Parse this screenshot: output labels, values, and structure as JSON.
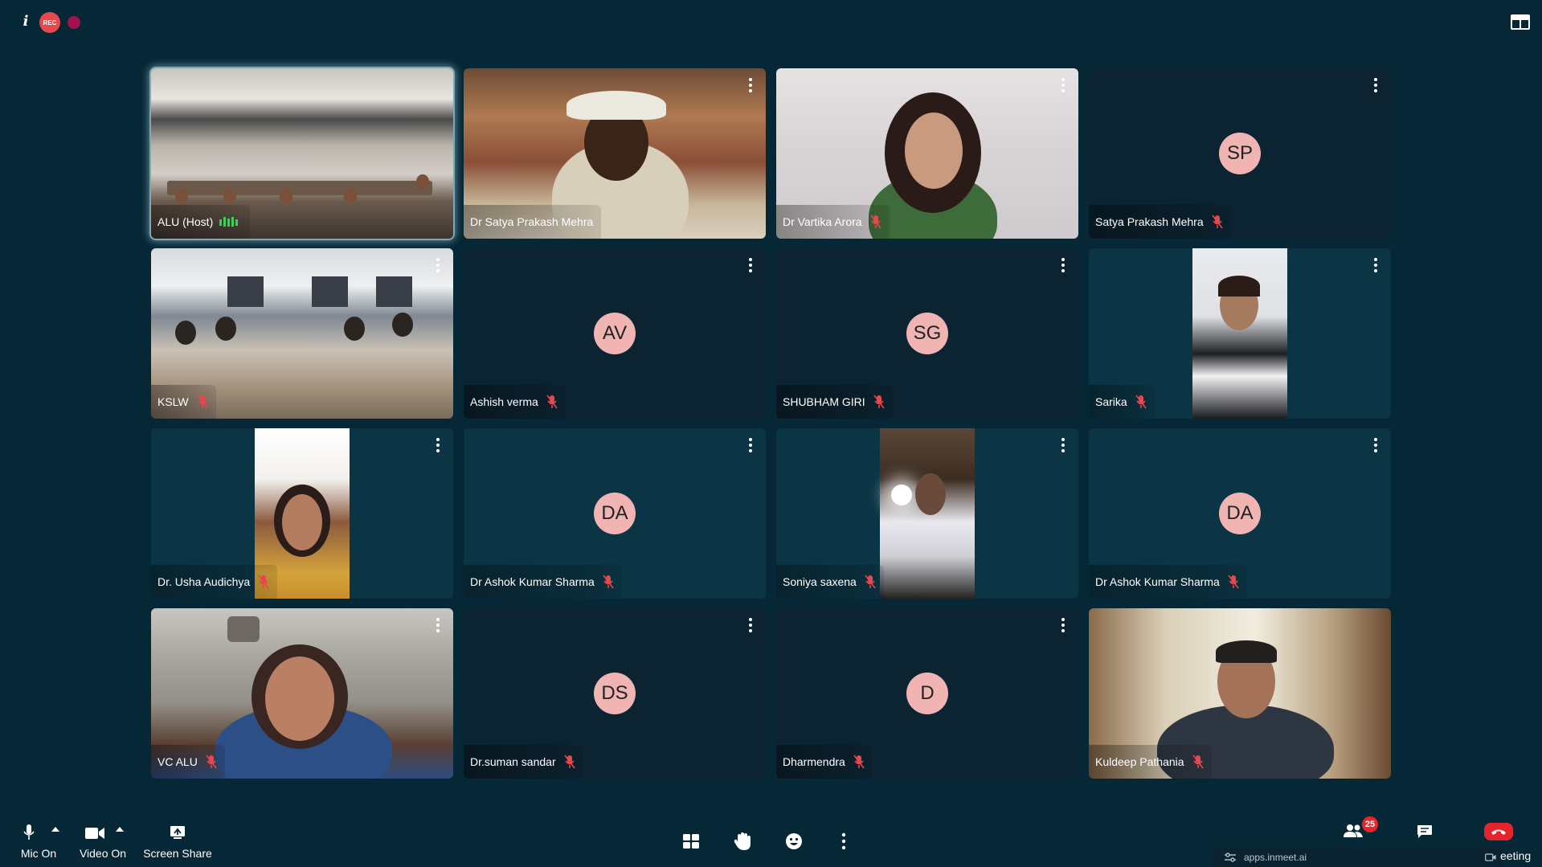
{
  "topbar": {
    "info_icon": "i",
    "rec_label": "REC"
  },
  "participants": [
    {
      "name": "ALU (Host)",
      "avatar": null
    },
    {
      "name": "Dr Satya Prakash Mehra",
      "avatar": null
    },
    {
      "name": "Dr Vartika Arora",
      "avatar": null
    },
    {
      "name": "Satya Prakash Mehra",
      "avatar": "SP"
    },
    {
      "name": "KSLW",
      "avatar": null
    },
    {
      "name": "Ashish verma",
      "avatar": "AV"
    },
    {
      "name": "SHUBHAM GIRI",
      "avatar": "SG"
    },
    {
      "name": "Sarika",
      "avatar": null
    },
    {
      "name": "Dr. Usha Audichya",
      "avatar": null
    },
    {
      "name": "Dr Ashok Kumar Sharma",
      "avatar": "DA"
    },
    {
      "name": "Soniya saxena",
      "avatar": null
    },
    {
      "name": "Dr Ashok Kumar Sharma",
      "avatar": "DA"
    },
    {
      "name": "VC ALU",
      "avatar": null
    },
    {
      "name": "Dr.suman sandar",
      "avatar": "DS"
    },
    {
      "name": "Dharmendra",
      "avatar": "D"
    },
    {
      "name": "Kuldeep Pathania",
      "avatar": null
    }
  ],
  "controls": {
    "mic_label": "Mic On",
    "video_label": "Video On",
    "share_label": "Screen Share",
    "participants_count": "25",
    "end_fragment": "eeting"
  },
  "url_strip": {
    "url": "apps.inmeet.ai"
  },
  "colors": {
    "background": "#062735",
    "avatar": "#f0b5b2",
    "end_call": "#e5242b",
    "rec": "#e5484d"
  }
}
